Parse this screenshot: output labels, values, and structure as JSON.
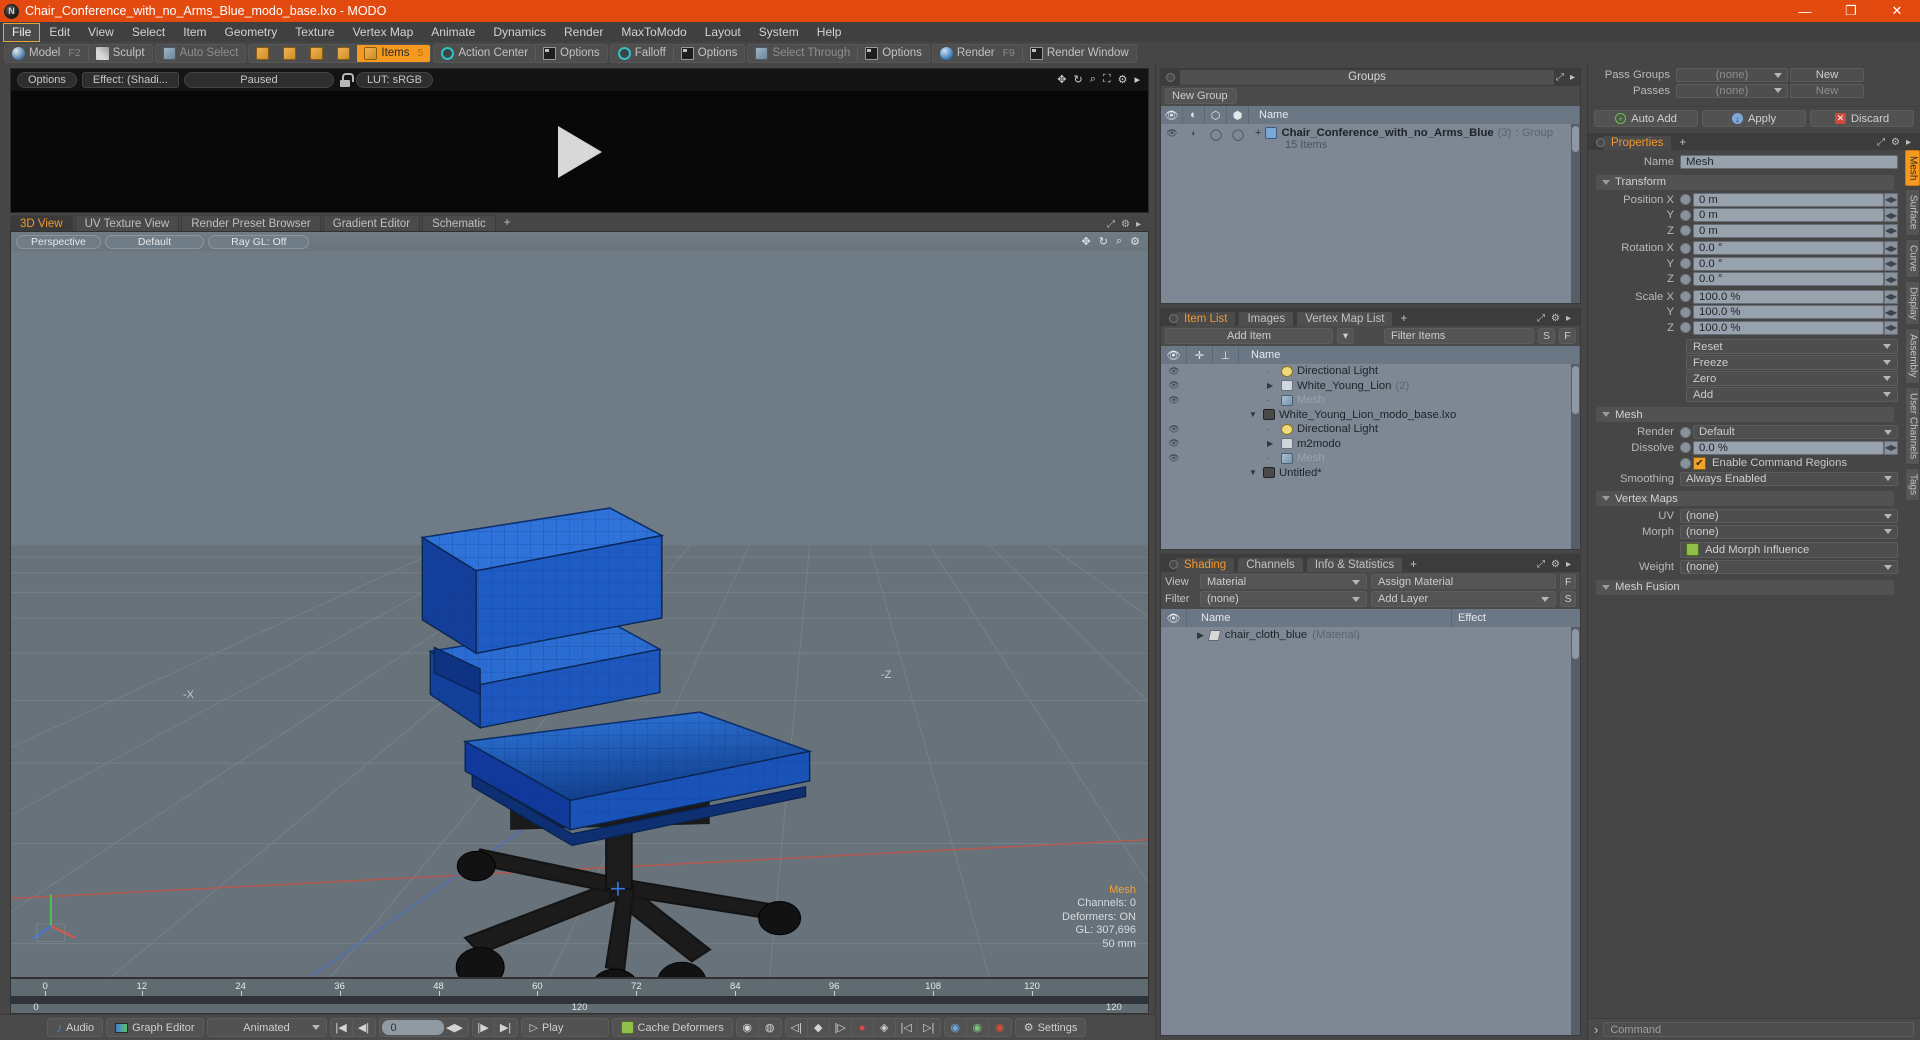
{
  "window": {
    "title": "Chair_Conference_with_no_Arms_Blue_modo_base.lxo - MODO",
    "logo": "modo-logo-icon",
    "minimize": "—",
    "maximize": "❐",
    "close": "✕"
  },
  "menubar": {
    "items": [
      "File",
      "Edit",
      "View",
      "Select",
      "Item",
      "Geometry",
      "Texture",
      "Vertex Map",
      "Animate",
      "Dynamics",
      "Render",
      "MaxToModo",
      "Layout",
      "System",
      "Help"
    ],
    "active": "File"
  },
  "modebar": {
    "model": "Model",
    "model_key": "F2",
    "sculpt": "Sculpt",
    "auto_select": "Auto Select",
    "items": "Items",
    "items_key": "5",
    "action_center": "Action Center",
    "options1": "Options",
    "falloff": "Falloff",
    "options2": "Options",
    "select_through": "Select Through",
    "options3": "Options",
    "render": "Render",
    "render_key": "F9",
    "render_window": "Render Window"
  },
  "render_preview": {
    "options": "Options",
    "effect": "Effect: (Shadi...",
    "paused": "Paused",
    "lut": "LUT: sRGB",
    "lock_icon": "lock-icon",
    "play_icon": "play-triangle-icon"
  },
  "viewport_tabs": {
    "tabs": [
      "3D View",
      "UV Texture View",
      "Render Preset Browser",
      "Gradient Editor",
      "Schematic"
    ],
    "selected": "3D View",
    "add": "+"
  },
  "viewport": {
    "projection": "Perspective",
    "style": "Default",
    "raygl": "Ray GL: Off",
    "hud": {
      "title": "Mesh",
      "channels": "Channels: 0",
      "deformers": "Deformers: ON",
      "gl": "GL: 307,696",
      "scale": "50 mm"
    },
    "axis_labels": {
      "x": "-X",
      "z": "-Z"
    }
  },
  "timeline": {
    "top_ticks": [
      "0",
      "12",
      "24",
      "36",
      "48",
      "60",
      "72",
      "84",
      "96",
      "108",
      "120"
    ],
    "center_label": "120",
    "start_label": "0",
    "end_label": "120"
  },
  "bottombar": {
    "audio": "Audio",
    "graph_editor": "Graph Editor",
    "animated": "Animated",
    "frame": "0",
    "play": "Play",
    "cache_deformers": "Cache Deformers",
    "settings": "Settings",
    "icons": [
      "first-frame-icon",
      "prev-frame-icon",
      "next-frame-icon",
      "last-frame-icon",
      "record-icon",
      "key-icon",
      "autokey-icon"
    ]
  },
  "groups_panel": {
    "title": "Groups",
    "new_group": "New Group",
    "columns": [
      "eye-icon",
      "render-icon",
      "shape-icon",
      "shade-icon",
      "Name"
    ],
    "name_header": "Name",
    "rows": [
      {
        "expand": "+",
        "icon": "group-shield-icon",
        "name": "Chair_Conference_with_no_Arms_Blue",
        "count": "(3)",
        "type": ": Group",
        "sub": "15 Items"
      }
    ]
  },
  "item_list_panel": {
    "tabs": [
      "Item List",
      "Images",
      "Vertex Map List"
    ],
    "selected": "Item List",
    "add": "+",
    "add_item": "Add Item",
    "filter_placeholder": "Filter Items",
    "btn_s": "S",
    "btn_f": "F",
    "name_header": "Name",
    "rows": [
      {
        "depth": 0,
        "disclose": "down",
        "icon": "scene-icon",
        "name": "Untitled*",
        "extra": "",
        "eye": false,
        "dim": false
      },
      {
        "depth": 1,
        "disclose": "leaf",
        "icon": "mesh-cube-icon",
        "name": "Mesh",
        "extra": "",
        "eye": true,
        "dim": true
      },
      {
        "depth": 1,
        "disclose": "right",
        "icon": "folder-icon",
        "name": "m2modo",
        "extra": "",
        "eye": true,
        "dim": false
      },
      {
        "depth": 1,
        "disclose": "leaf",
        "icon": "light-icon",
        "name": "Directional Light",
        "extra": "",
        "eye": true,
        "dim": false
      },
      {
        "depth": 0,
        "disclose": "down",
        "icon": "scene-icon",
        "name": "White_Young_Lion_modo_base.lxo",
        "extra": "",
        "eye": false,
        "dim": false
      },
      {
        "depth": 1,
        "disclose": "leaf",
        "icon": "mesh-cube-icon",
        "name": "Mesh",
        "extra": "",
        "eye": true,
        "dim": true
      },
      {
        "depth": 1,
        "disclose": "right",
        "icon": "folder-icon",
        "name": "White_Young_Lion",
        "extra": "(2)",
        "eye": true,
        "dim": false
      },
      {
        "depth": 1,
        "disclose": "leaf",
        "icon": "light-icon",
        "name": "Directional Light",
        "extra": "",
        "eye": true,
        "dim": false
      }
    ]
  },
  "shading_panel": {
    "tabs": [
      "Shading",
      "Channels",
      "Info & Statistics"
    ],
    "selected": "Shading",
    "add": "+",
    "view_label": "View",
    "view_value": "Material",
    "assign_material": "Assign Material",
    "btn_f": "F",
    "filter_label": "Filter",
    "filter_value": "(none)",
    "add_layer": "Add Layer",
    "btn_s": "S",
    "col_name": "Name",
    "col_effect": "Effect",
    "rows": [
      {
        "name": "chair_cloth_blue",
        "type": "(Material)",
        "effect": ""
      }
    ]
  },
  "properties": {
    "pass_groups_label": "Pass Groups",
    "pass_groups_value": "(none)",
    "pass_groups_new": "New",
    "passes_label": "Passes",
    "passes_value": "(none)",
    "passes_new": "New",
    "auto_add": "Auto Add",
    "apply": "Apply",
    "discard": "Discard",
    "tab": "Properties",
    "tab_add": "+",
    "name_label": "Name",
    "name_value": "Mesh",
    "transform_section": "Transform",
    "position_label": "Position X",
    "position": [
      "0 m",
      "0 m",
      "0 m"
    ],
    "rotation_label": "Rotation X",
    "rotation": [
      "0.0 °",
      "0.0 °",
      "0.0 °"
    ],
    "scale_label": "Scale X",
    "scale": [
      "100.0 %",
      "100.0 %",
      "100.0 %"
    ],
    "axis_y": "Y",
    "axis_z": "Z",
    "dropdowns": [
      "Reset",
      "Freeze",
      "Zero",
      "Add"
    ],
    "mesh_section": "Mesh",
    "render_label": "Render",
    "render_value": "Default",
    "dissolve_label": "Dissolve",
    "dissolve_value": "0.0 %",
    "enable_command_regions": "Enable Command Regions",
    "smoothing_label": "Smoothing",
    "smoothing_value": "Always Enabled",
    "vertex_maps_section": "Vertex Maps",
    "uv_label": "UV",
    "uv_value": "(none)",
    "morph_label": "Morph",
    "morph_value": "(none)",
    "add_morph_influence": "Add Morph Influence",
    "weight_label": "Weight",
    "weight_value": "(none)",
    "mesh_fusion_section": "Mesh Fusion",
    "side_tabs": [
      "Mesh",
      "Surface",
      "Curve",
      "Display",
      "Assembly",
      "User Channels",
      "Tags"
    ],
    "side_tab_selected": "Mesh"
  },
  "command_bar": {
    "arrow": "›",
    "placeholder": "Command"
  },
  "colors": {
    "title_bar": "#e24a10",
    "accent": "#f59a1e",
    "panel": "#4a4a4a",
    "list": "#7d8894",
    "list_header": "#6b7785",
    "chair_blue": "#1b5fc4"
  }
}
